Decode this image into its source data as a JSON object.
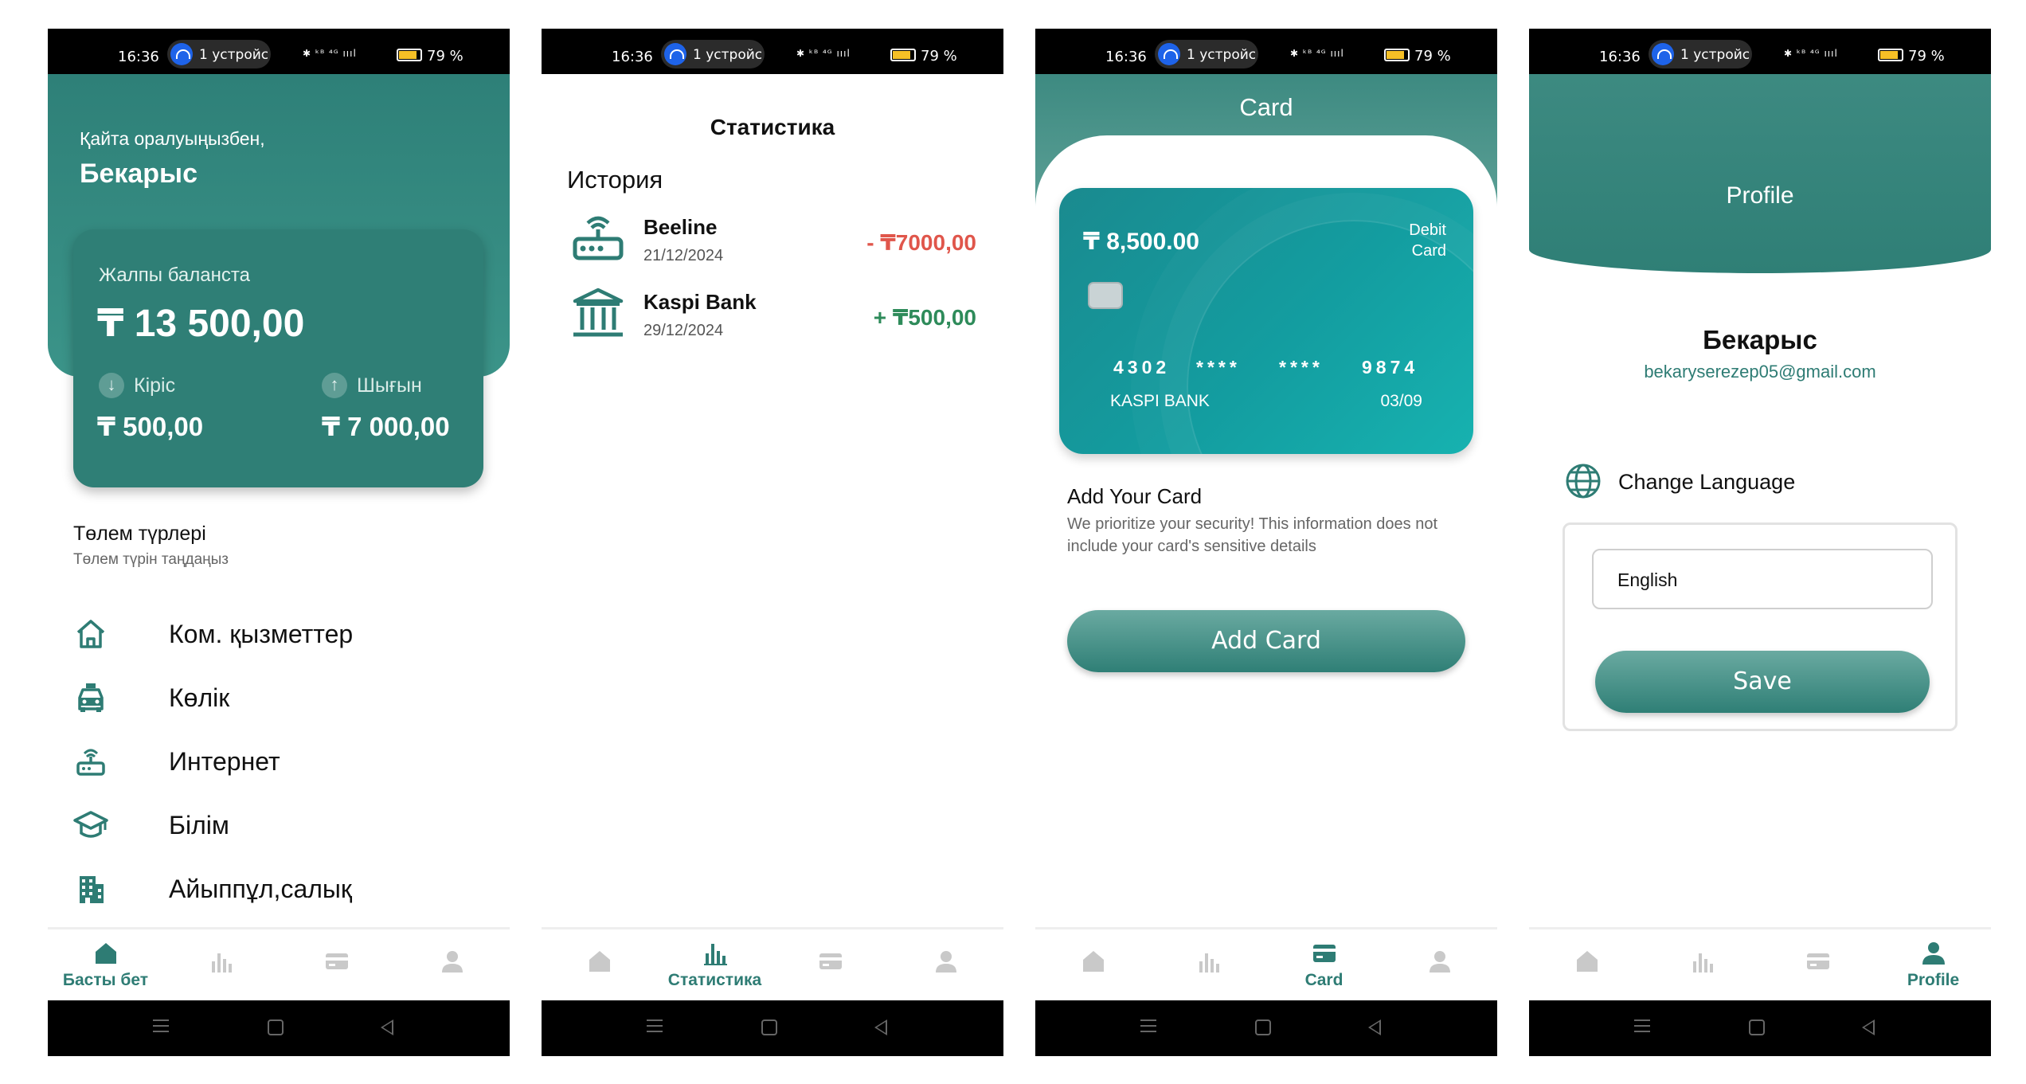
{
  "status": {
    "time": "16:36",
    "pill": "1 устройст",
    "icons": "✱ ᵏᴮ ⁴ᴳ ıııl",
    "battery": "79 %"
  },
  "tabs": {
    "home": "Басты бет",
    "stats": "Статистика",
    "card": "Card",
    "profile": "Profile"
  },
  "home": {
    "greeting": "Қайта оралуыңызбен,",
    "user": "Бекарыс",
    "balance_label": "Жалпы баланста",
    "balance": "₸ 13 500,00",
    "income_label": "Кіріс",
    "income": "₸ 500,00",
    "expense_label": "Шығын",
    "expense": "₸ 7 000,00",
    "payments_title": "Төлем түрлері",
    "payments_sub": "Төлем түрін таңдаңыз",
    "payments": [
      {
        "label": "Ком. қызметтер",
        "icon": "house-icon"
      },
      {
        "label": "Көлік",
        "icon": "taxi-icon"
      },
      {
        "label": "Интернет",
        "icon": "router-icon"
      },
      {
        "label": "Білім",
        "icon": "graduation-cap-icon"
      },
      {
        "label": "Айыппұл,салық",
        "icon": "building-icon"
      }
    ]
  },
  "stats": {
    "title": "Статистика",
    "history": "История",
    "transactions": [
      {
        "name": "Beeline",
        "date": "21/12/2024",
        "amount": "- ₸7000,00",
        "color": "#e0564b",
        "icon": "router-icon"
      },
      {
        "name": "Kaspi Bank",
        "date": "29/12/2024",
        "amount": "+ ₸500,00",
        "color": "#2e8b5a",
        "icon": "bank-icon"
      }
    ]
  },
  "card": {
    "title": "Card",
    "amount": "₸ 8,500.00",
    "type_line1": "Debit",
    "type_line2": "Card",
    "number": [
      "4302",
      "****",
      "****",
      "9874"
    ],
    "bank": "KASPI BANK",
    "expiry": "03/09",
    "add_title": "Add Your Card",
    "add_desc": "We prioritize your security! This information does not include your card's sensitive details",
    "button": "Add Card"
  },
  "profile": {
    "title": "Profile",
    "name": "Бекарыс",
    "email": "bekaryserezep05@gmail.com",
    "change_language": "Change Language",
    "language": "English",
    "save": "Save"
  },
  "colors": {
    "primary": "#2e7c74",
    "expense": "#e0564b",
    "income": "#2e8b5a",
    "inactive_icon": "#c9c9c9"
  }
}
